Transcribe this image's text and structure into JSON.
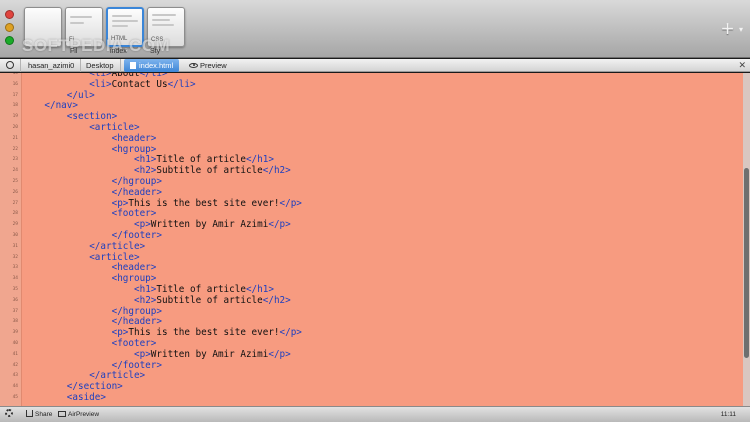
{
  "window": {
    "watermark": "SOFTPEDIA.COM"
  },
  "toolbar": {
    "thumbnails": [
      {
        "label": ""
      },
      {
        "label": "Fi"
      },
      {
        "label": "HTML"
      },
      {
        "label": "CSS"
      }
    ],
    "captions": [
      "Fil",
      "index",
      "Sty"
    ],
    "add_icon": "+",
    "add_caret": "▾"
  },
  "pathbar": {
    "home": "hasan_azimi0",
    "folder": "Desktop",
    "file": "index.html",
    "preview": "Preview",
    "close": "✕"
  },
  "editor": {
    "lines": [
      {
        "n": "15",
        "indent": 12,
        "parts": [
          [
            "t",
            "<li>"
          ],
          [
            "x",
            "About"
          ],
          [
            "t",
            "</li>"
          ]
        ]
      },
      {
        "n": "16",
        "indent": 12,
        "parts": [
          [
            "t",
            "<li>"
          ],
          [
            "x",
            "Contact Us"
          ],
          [
            "t",
            "</li>"
          ]
        ]
      },
      {
        "n": "17",
        "indent": 8,
        "parts": [
          [
            "t",
            "</ul>"
          ]
        ]
      },
      {
        "n": "18",
        "indent": 4,
        "parts": [
          [
            "t",
            "</nav>"
          ]
        ]
      },
      {
        "n": "19",
        "indent": 8,
        "parts": [
          [
            "t",
            "<section>"
          ]
        ]
      },
      {
        "n": "20",
        "indent": 12,
        "parts": [
          [
            "t",
            "<article>"
          ]
        ]
      },
      {
        "n": "21",
        "indent": 16,
        "parts": [
          [
            "t",
            "<header>"
          ]
        ]
      },
      {
        "n": "22",
        "indent": 16,
        "parts": [
          [
            "t",
            "<hgroup>"
          ]
        ]
      },
      {
        "n": "23",
        "indent": 20,
        "parts": [
          [
            "t",
            "<h1>"
          ],
          [
            "x",
            "Title of article"
          ],
          [
            "t",
            "</h1>"
          ]
        ]
      },
      {
        "n": "24",
        "indent": 20,
        "parts": [
          [
            "t",
            "<h2>"
          ],
          [
            "x",
            "Subtitle of article"
          ],
          [
            "t",
            "</h2>"
          ]
        ]
      },
      {
        "n": "25",
        "indent": 16,
        "parts": [
          [
            "t",
            "</hgroup>"
          ]
        ]
      },
      {
        "n": "26",
        "indent": 16,
        "parts": [
          [
            "t",
            "</header>"
          ]
        ]
      },
      {
        "n": "27",
        "indent": 16,
        "parts": [
          [
            "t",
            "<p>"
          ],
          [
            "x",
            "This is the best site ever!"
          ],
          [
            "t",
            "</p>"
          ]
        ]
      },
      {
        "n": "28",
        "indent": 16,
        "parts": [
          [
            "t",
            "<footer>"
          ]
        ]
      },
      {
        "n": "29",
        "indent": 20,
        "parts": [
          [
            "t",
            "<p>"
          ],
          [
            "x",
            "Written by Amir Azimi"
          ],
          [
            "t",
            "</p>"
          ]
        ]
      },
      {
        "n": "30",
        "indent": 16,
        "parts": [
          [
            "t",
            "</footer>"
          ]
        ]
      },
      {
        "n": "31",
        "indent": 12,
        "parts": [
          [
            "t",
            "</article>"
          ]
        ]
      },
      {
        "n": "32",
        "indent": 12,
        "parts": [
          [
            "t",
            "<article>"
          ]
        ]
      },
      {
        "n": "33",
        "indent": 16,
        "parts": [
          [
            "t",
            "<header>"
          ]
        ]
      },
      {
        "n": "34",
        "indent": 16,
        "parts": [
          [
            "t",
            "<hgroup>"
          ]
        ]
      },
      {
        "n": "35",
        "indent": 20,
        "parts": [
          [
            "t",
            "<h1>"
          ],
          [
            "x",
            "Title of article"
          ],
          [
            "t",
            "</h1>"
          ]
        ]
      },
      {
        "n": "36",
        "indent": 20,
        "parts": [
          [
            "t",
            "<h2>"
          ],
          [
            "x",
            "Subtitle of article"
          ],
          [
            "t",
            "</h2>"
          ]
        ]
      },
      {
        "n": "37",
        "indent": 16,
        "parts": [
          [
            "t",
            "</hgroup>"
          ]
        ]
      },
      {
        "n": "38",
        "indent": 16,
        "parts": [
          [
            "t",
            "</header>"
          ]
        ]
      },
      {
        "n": "39",
        "indent": 16,
        "parts": [
          [
            "t",
            "<p>"
          ],
          [
            "x",
            "This is the best site ever!"
          ],
          [
            "t",
            "</p>"
          ]
        ]
      },
      {
        "n": "40",
        "indent": 16,
        "parts": [
          [
            "t",
            "<footer>"
          ]
        ]
      },
      {
        "n": "41",
        "indent": 20,
        "parts": [
          [
            "t",
            "<p>"
          ],
          [
            "x",
            "Written by Amir Azimi"
          ],
          [
            "t",
            "</p>"
          ]
        ]
      },
      {
        "n": "42",
        "indent": 16,
        "parts": [
          [
            "t",
            "</footer>"
          ]
        ]
      },
      {
        "n": "43",
        "indent": 12,
        "parts": [
          [
            "t",
            "</article>"
          ]
        ]
      },
      {
        "n": "44",
        "indent": 8,
        "parts": [
          [
            "t",
            "</section>"
          ]
        ]
      },
      {
        "n": "45",
        "indent": 8,
        "parts": [
          [
            "t",
            "<aside>"
          ]
        ]
      }
    ],
    "background": "#f79b80",
    "tag_color": "#1c3fc0"
  },
  "statusbar": {
    "share": "Share",
    "airpreview": "AirPreview",
    "position": "11:11"
  }
}
